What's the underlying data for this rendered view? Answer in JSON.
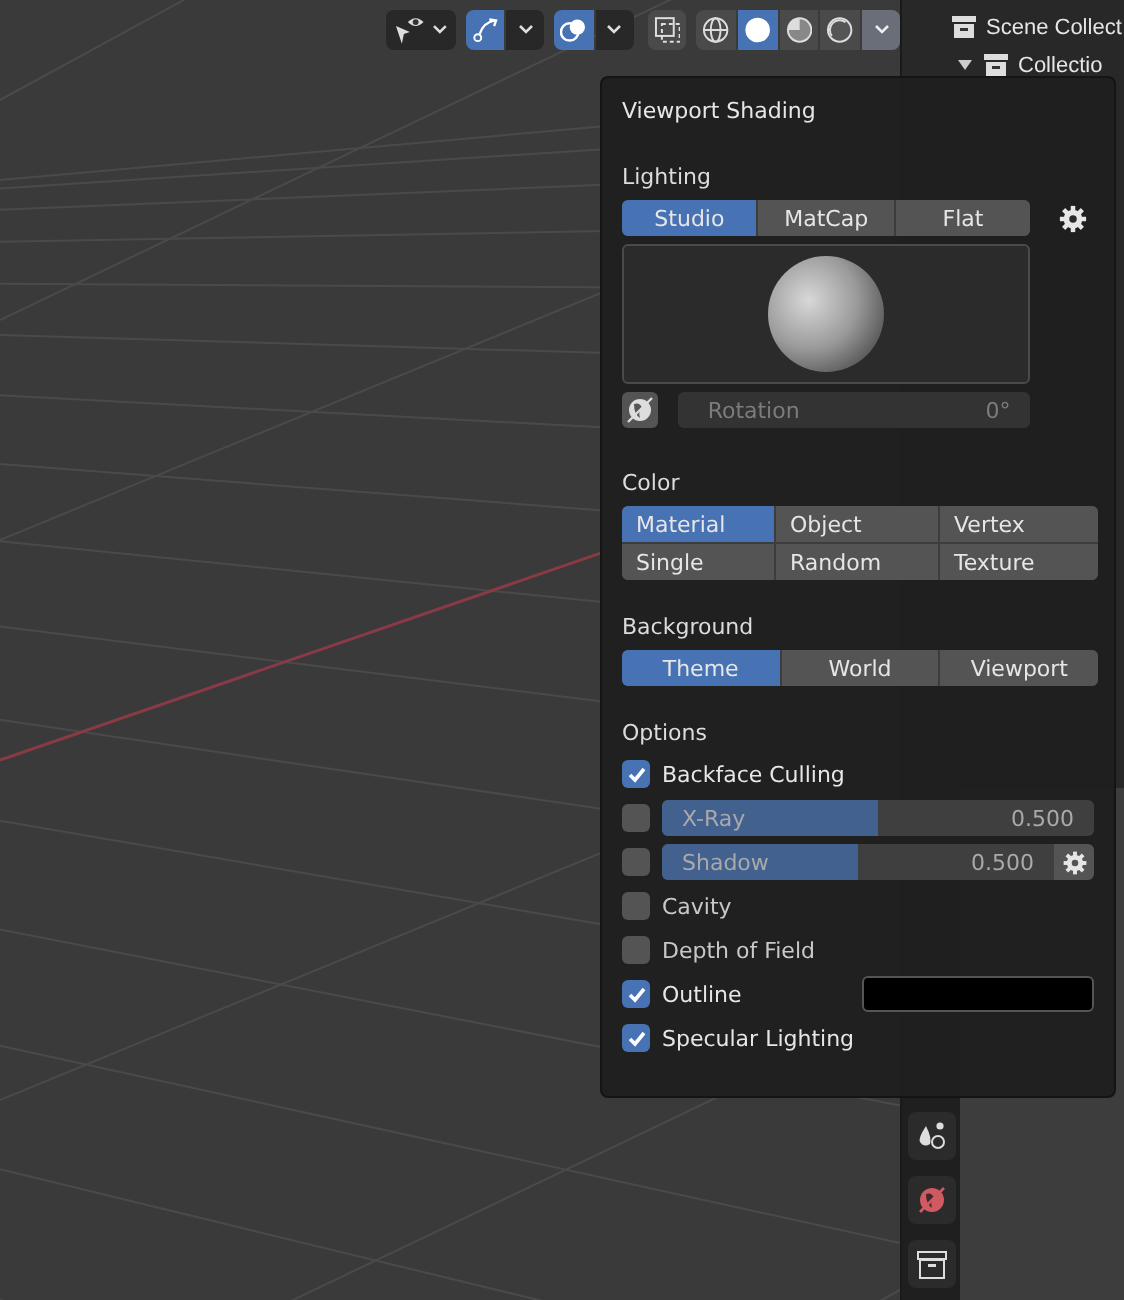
{
  "toolbar": {
    "gizmos_on": true,
    "overlays_on": true,
    "xray_on": false,
    "shading_modes": [
      {
        "kind": "wireframe",
        "selected": false
      },
      {
        "kind": "solid",
        "selected": true
      },
      {
        "kind": "material",
        "selected": false
      },
      {
        "kind": "rendered",
        "selected": false
      }
    ],
    "shading_menu_open": true
  },
  "outliner": {
    "items": [
      {
        "kind": "scene",
        "label": "Scene Collect"
      },
      {
        "kind": "collection",
        "label": "Collectio",
        "expanded": true
      }
    ]
  },
  "popup": {
    "title": "Viewport Shading",
    "lighting": {
      "label": "Lighting",
      "options": [
        {
          "label": "Studio",
          "selected": true
        },
        {
          "label": "MatCap",
          "selected": false
        },
        {
          "label": "Flat",
          "selected": false
        }
      ],
      "rotation": {
        "label": "Rotation",
        "value": "0°",
        "disabled": true
      }
    },
    "color": {
      "label": "Color",
      "options": [
        {
          "label": "Material",
          "selected": true
        },
        {
          "label": "Object",
          "selected": false
        },
        {
          "label": "Vertex",
          "selected": false
        },
        {
          "label": "Single",
          "selected": false
        },
        {
          "label": "Random",
          "selected": false
        },
        {
          "label": "Texture",
          "selected": false
        }
      ]
    },
    "background": {
      "label": "Background",
      "options": [
        {
          "label": "Theme",
          "selected": true
        },
        {
          "label": "World",
          "selected": false
        },
        {
          "label": "Viewport",
          "selected": false
        }
      ]
    },
    "options": {
      "label": "Options",
      "items": [
        {
          "kind": "checkbox",
          "label": "Backface Culling",
          "checked": true
        },
        {
          "kind": "slider",
          "label": "X-Ray",
          "checked": false,
          "level": 0.5,
          "reading": "0.500"
        },
        {
          "kind": "slider",
          "label": "Shadow",
          "checked": false,
          "level": 0.5,
          "reading": "0.500",
          "settings": true
        },
        {
          "kind": "checkbox",
          "label": "Cavity",
          "checked": false
        },
        {
          "kind": "checkbox",
          "label": "Depth of Field",
          "checked": false
        },
        {
          "kind": "color",
          "label": "Outline",
          "checked": true,
          "color": "#000000"
        },
        {
          "kind": "checkbox",
          "label": "Specular Lighting",
          "checked": true
        }
      ]
    }
  },
  "properties_tabs": [
    {
      "kind": "physics",
      "selected": false
    },
    {
      "kind": "world",
      "selected": false
    },
    {
      "kind": "collection",
      "selected": false
    }
  ]
}
